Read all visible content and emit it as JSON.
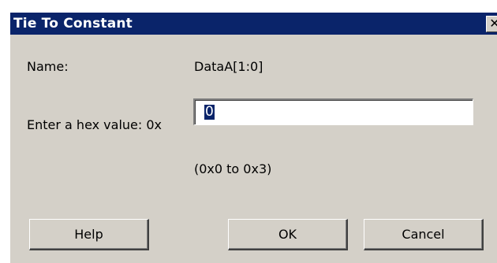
{
  "dialog": {
    "title": "Tie To Constant",
    "close_glyph": "✕",
    "name_label": "Name:",
    "name_value": "DataA[1:0]",
    "hex_label": "Enter a hex value: 0x",
    "hex_value": "0",
    "range_text": "(0x0 to 0x3)",
    "buttons": {
      "help": "Help",
      "ok": "OK",
      "cancel": "Cancel"
    }
  },
  "colors": {
    "titlebar": "#0a246a",
    "face": "#d4d0c8",
    "selection": "#0a246a"
  }
}
